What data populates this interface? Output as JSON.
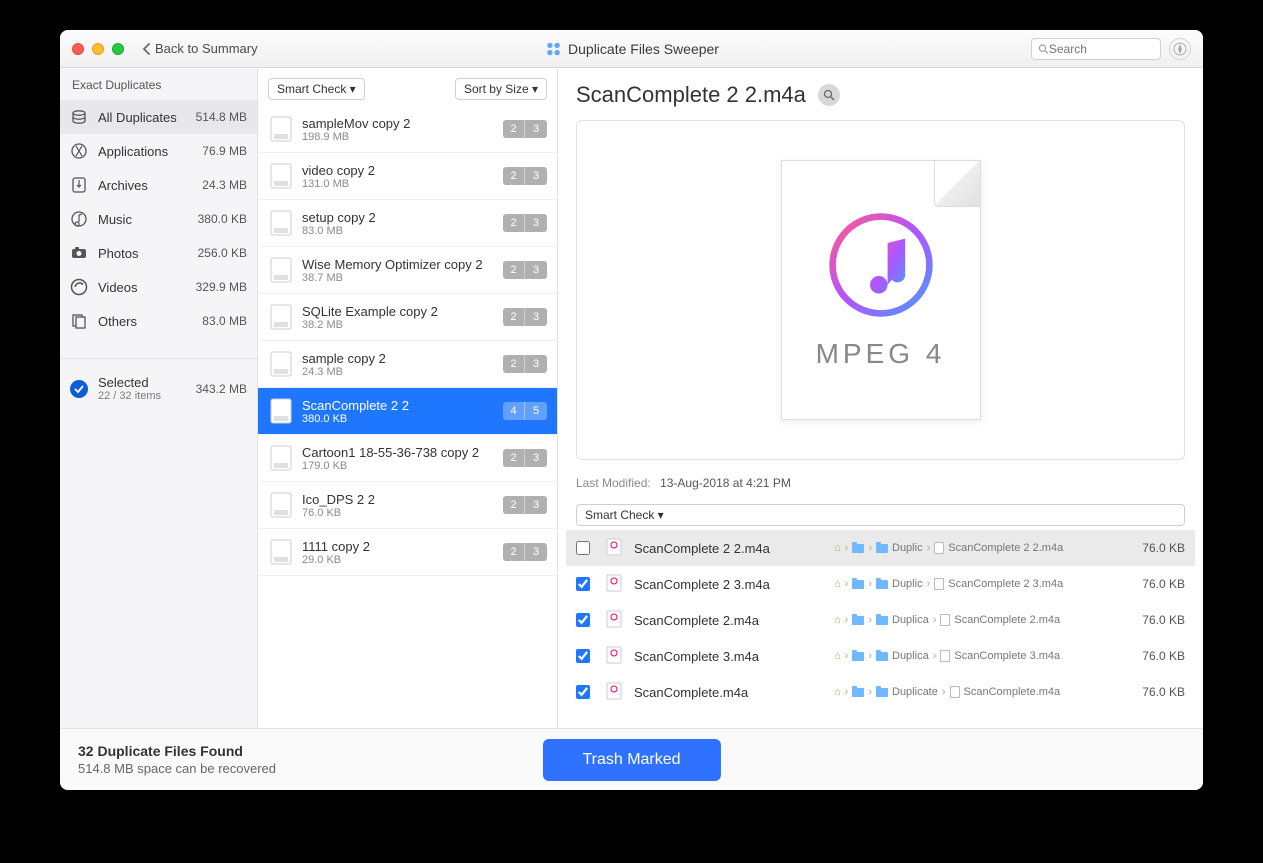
{
  "titlebar": {
    "back_label": "Back to Summary",
    "app_title": "Duplicate Files Sweeper",
    "search_placeholder": "Search"
  },
  "sidebar": {
    "header": "Exact Duplicates",
    "categories": [
      {
        "name": "All Duplicates",
        "size": "514.8 MB",
        "selected": true
      },
      {
        "name": "Applications",
        "size": "76.9 MB"
      },
      {
        "name": "Archives",
        "size": "24.3 MB"
      },
      {
        "name": "Music",
        "size": "380.0 KB"
      },
      {
        "name": "Photos",
        "size": "256.0 KB"
      },
      {
        "name": "Videos",
        "size": "329.9 MB"
      },
      {
        "name": "Others",
        "size": "83.0 MB"
      }
    ],
    "selected": {
      "label": "Selected",
      "sub": "22 / 32 items",
      "size": "343.2 MB"
    }
  },
  "mid": {
    "smart_check": "Smart Check ▾",
    "sort_by": "Sort by Size ▾",
    "files": [
      {
        "name": "sampleMov copy 2",
        "size": "198.9 MB",
        "b1": "2",
        "b2": "3"
      },
      {
        "name": "video copy 2",
        "size": "131.0 MB",
        "b1": "2",
        "b2": "3"
      },
      {
        "name": "setup copy 2",
        "size": "83.0 MB",
        "b1": "2",
        "b2": "3"
      },
      {
        "name": "Wise Memory Optimizer copy 2",
        "size": "38.7 MB",
        "b1": "2",
        "b2": "3"
      },
      {
        "name": "SQLite Example copy 2",
        "size": "38.2 MB",
        "b1": "2",
        "b2": "3"
      },
      {
        "name": "sample copy 2",
        "size": "24.3 MB",
        "b1": "2",
        "b2": "3"
      },
      {
        "name": "ScanComplete 2 2",
        "size": "380.0 KB",
        "b1": "4",
        "b2": "5",
        "active": true
      },
      {
        "name": "Cartoon1 18-55-36-738 copy 2",
        "size": "179.0 KB",
        "b1": "2",
        "b2": "3"
      },
      {
        "name": "Ico_DPS 2 2",
        "size": "76.0 KB",
        "b1": "2",
        "b2": "3"
      },
      {
        "name": "1111 copy 2",
        "size": "29.0 KB",
        "b1": "2",
        "b2": "3"
      }
    ]
  },
  "detail": {
    "title": "ScanComplete 2 2.m4a",
    "preview_label": "MPEG 4",
    "meta_label": "Last Modified:",
    "meta_value": "13-Aug-2018 at 4:21 PM",
    "smart_check": "Smart Check ▾",
    "dups": [
      {
        "checked": false,
        "name": "ScanComplete 2 2.m4a",
        "path1": "Duplic",
        "leaf": "ScanComplete 2 2.m4a",
        "size": "76.0 KB",
        "first": true
      },
      {
        "checked": true,
        "name": "ScanComplete 2 3.m4a",
        "path1": "Duplic",
        "leaf": "ScanComplete 2 3.m4a",
        "size": "76.0 KB"
      },
      {
        "checked": true,
        "name": "ScanComplete 2.m4a",
        "path1": "Duplica",
        "leaf": "ScanComplete 2.m4a",
        "size": "76.0 KB"
      },
      {
        "checked": true,
        "name": "ScanComplete 3.m4a",
        "path1": "Duplica",
        "leaf": "ScanComplete 3.m4a",
        "size": "76.0 KB"
      },
      {
        "checked": true,
        "name": "ScanComplete.m4a",
        "path1": "Duplicate",
        "leaf": "ScanComplete.m4a",
        "size": "76.0 KB"
      }
    ]
  },
  "footer": {
    "line1": "32 Duplicate Files Found",
    "line2": "514.8 MB space can be recovered",
    "trash": "Trash Marked"
  }
}
